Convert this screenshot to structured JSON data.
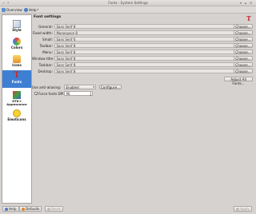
{
  "window": {
    "title": "Fonts - System Settings"
  },
  "toolbar": {
    "overview_label": "Overview",
    "help_label": "Help"
  },
  "sidebar": {
    "items": [
      {
        "label": "Style",
        "icon": "style-icon"
      },
      {
        "label": "Colors",
        "icon": "colors-icon"
      },
      {
        "label": "Icons",
        "icon": "icons-icon"
      },
      {
        "label": "Fonts",
        "icon": "fonts-icon",
        "selected": true
      },
      {
        "label": "GTK+ Appearance",
        "icon": "gtk-icon"
      },
      {
        "label": "Emoticons",
        "icon": "emoticons-icon"
      }
    ]
  },
  "main": {
    "heading": "Font settings",
    "rows": [
      {
        "label": "General:",
        "value": "Sans Serif 8",
        "button": "Choose..."
      },
      {
        "label": "Fixed width:",
        "value": "Monospace 8",
        "button": "Choose..."
      },
      {
        "label": "Small:",
        "value": "Sans Serif 6",
        "button": "Choose..."
      },
      {
        "label": "Toolbar:",
        "value": "Sans Serif 8",
        "button": "Choose..."
      },
      {
        "label": "Menu:",
        "value": "Sans Serif 8",
        "button": "Choose..."
      },
      {
        "label": "Window title:",
        "value": "Sans Serif 8",
        "button": "Choose..."
      },
      {
        "label": "Taskbar:",
        "value": "Sans Serif 8",
        "button": "Choose..."
      },
      {
        "label": "Desktop:",
        "value": "Sans Serif 8",
        "button": "Choose..."
      }
    ],
    "adjust_all_label": "Adjust All Fonts...",
    "antialiasing": {
      "label": "Use anti-aliasing:",
      "value": "Enabled",
      "configure_label": "Configure..."
    },
    "force_dpi": {
      "label": "Force fonts DPI:",
      "value": "96",
      "checked": true
    }
  },
  "bottom": {
    "help_label": "Help",
    "defaults_label": "Defaults",
    "reset_label": "Reset",
    "apply_label": "Apply"
  },
  "colors": {
    "selection": "#3e7fd4",
    "background": "#d6d2d0"
  }
}
